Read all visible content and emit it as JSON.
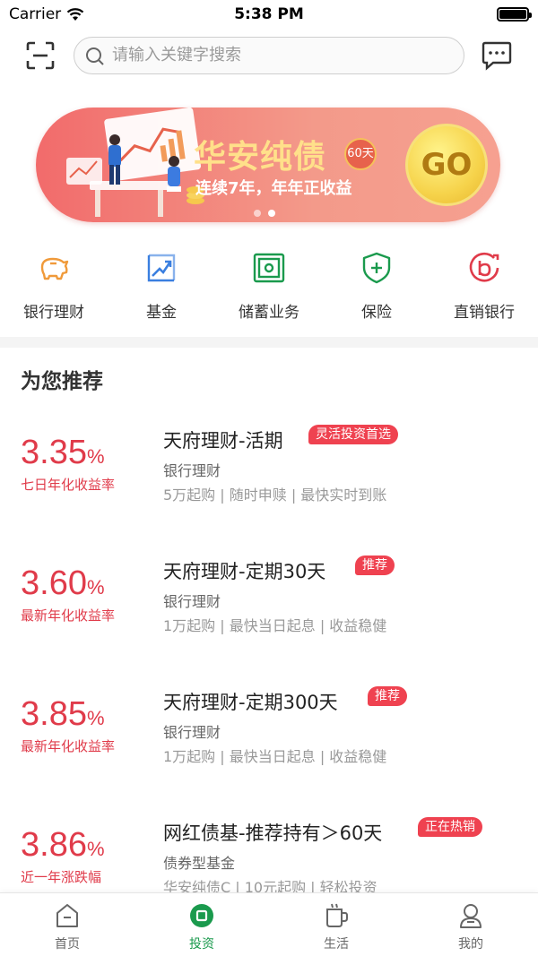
{
  "status": {
    "carrier": "Carrier",
    "time": "5:38 PM"
  },
  "search": {
    "placeholder": "请输入关键字搜索"
  },
  "banner": {
    "title": "华安纯债",
    "badge": "60天",
    "subtitle": "连续7年，年年正收益",
    "go": "GO",
    "colors": {
      "background": "#f26b6b",
      "title": "#ffe08a",
      "go": "#f6d34b"
    }
  },
  "categories": [
    {
      "label": "银行理财",
      "icon": "piggy-bank-icon",
      "color": "#f09a3a"
    },
    {
      "label": "基金",
      "icon": "chart-trend-icon",
      "color": "#3a7fe0"
    },
    {
      "label": "储蓄业务",
      "icon": "safe-box-icon",
      "color": "#1a9a4d"
    },
    {
      "label": "保险",
      "icon": "shield-plus-icon",
      "color": "#1a9a4d"
    },
    {
      "label": "直销银行",
      "icon": "direct-bank-icon",
      "color": "#e03b4a"
    }
  ],
  "section_title": "为您推荐",
  "products": [
    {
      "rate": "3.35",
      "unit": "%",
      "rate_label": "七日年化收益率",
      "title": "天府理财-活期",
      "tag": "灵活投资首选",
      "type": "银行理财",
      "desc": "5万起购 | 随时申赎 | 最快实时到账"
    },
    {
      "rate": "3.60",
      "unit": "%",
      "rate_label": "最新年化收益率",
      "title": "天府理财-定期30天",
      "tag": "推荐",
      "type": "银行理财",
      "desc": "1万起购 | 最快当日起息 | 收益稳健"
    },
    {
      "rate": "3.85",
      "unit": "%",
      "rate_label": "最新年化收益率",
      "title": "天府理财-定期300天",
      "tag": "推荐",
      "type": "银行理财",
      "desc": "1万起购 | 最快当日起息 | 收益稳健"
    },
    {
      "rate": "3.86",
      "unit": "%",
      "rate_label": "近一年涨跌幅",
      "title": "网红债基-推荐持有＞60天",
      "tag": "正在热销",
      "type": "债券型基金",
      "desc": "华安纯债C | 10元起购 | 轻松投资"
    }
  ],
  "tabs": [
    {
      "label": "首页",
      "icon": "home-icon",
      "active": false
    },
    {
      "label": "投资",
      "icon": "invest-icon",
      "active": true
    },
    {
      "label": "生活",
      "icon": "cup-icon",
      "active": false
    },
    {
      "label": "我的",
      "icon": "user-icon",
      "active": false
    }
  ],
  "colors": {
    "accent": "#1a9a4d",
    "rate": "#e03b4a",
    "tag": "#ef4250"
  }
}
